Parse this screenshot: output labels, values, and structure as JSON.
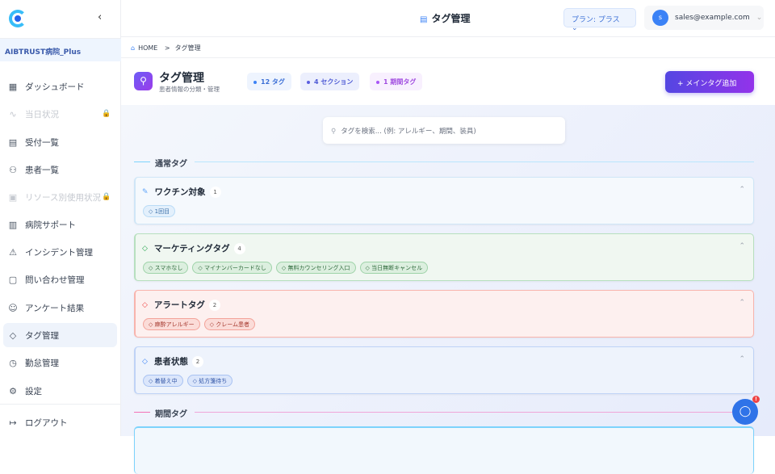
{
  "sidebar": {
    "hospital": "AIBTRUST病院_Plus",
    "collapse": "‹",
    "items": [
      {
        "label": "ダッシュボード",
        "icon": "▦"
      },
      {
        "label": "当日状況",
        "icon": "∿"
      },
      {
        "label": "受付一覧",
        "icon": "▤"
      },
      {
        "label": "患者一覧",
        "icon": "⚇"
      },
      {
        "label": "リソース別使用状況",
        "icon": "▣"
      },
      {
        "label": "病院サポート",
        "icon": "▥"
      },
      {
        "label": "インシデント管理",
        "icon": "⚠"
      },
      {
        "label": "問い合わせ管理",
        "icon": "▢"
      },
      {
        "label": "アンケート結果",
        "icon": "☺"
      },
      {
        "label": "タグ管理",
        "icon": "◇"
      },
      {
        "label": "勤怠管理",
        "icon": "◷"
      },
      {
        "label": "設定",
        "icon": "⚙"
      }
    ],
    "lock": "🔒",
    "logout": "ログアウト",
    "logout_icon": "↦"
  },
  "header": {
    "title": "タグ管理",
    "plan": "プラン: プラス ⌄",
    "user_initial": "s",
    "email": "sales@example.com",
    "user_chevron": "⌄"
  },
  "breadcrumb": {
    "home": "HOME",
    "sep": ">",
    "current": "タグ管理"
  },
  "page": {
    "title": "タグ管理",
    "subtitle": "患者情報の分類・管理",
    "chips": [
      "12 タグ",
      "4 セクション",
      "1 期間タグ"
    ],
    "add_button": "+ メインタグ追加"
  },
  "search": {
    "placeholder": "タグを検索... (例: アレルギー、期間、装具)"
  },
  "sections": {
    "normal": "通常タグ",
    "period": "期間タグ"
  },
  "cards": [
    {
      "title": "ワクチン対象",
      "count": "1",
      "tags": [
        "1回目"
      ]
    },
    {
      "title": "マーケティングタグ",
      "count": "4",
      "tags": [
        "スマホなし",
        "マイナンバーカードなし",
        "無料カウンセリング入口",
        "当日無断キャンセル"
      ]
    },
    {
      "title": "アラートタグ",
      "count": "2",
      "tags": [
        "麻酔アレルギー",
        "クレーム患者"
      ]
    },
    {
      "title": "患者状態",
      "count": "2",
      "tags": [
        "着替え中",
        "処方箋待ち"
      ]
    }
  ],
  "chat": {
    "badge": "!"
  },
  "colors": {
    "accent": "#6d5df6",
    "blue": "#3b82f6"
  }
}
